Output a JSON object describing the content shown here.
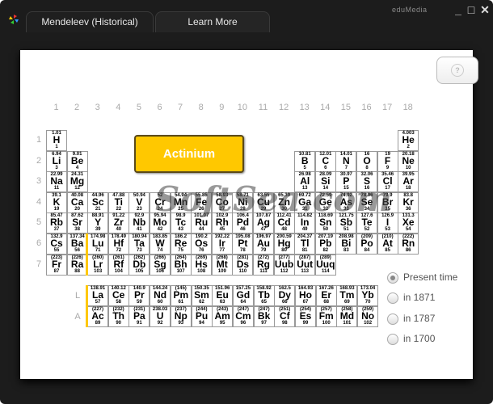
{
  "window": {
    "brand": "eduMedia",
    "controls": {
      "minimize": "_",
      "maximize": "□",
      "close": "✕"
    }
  },
  "tabs": [
    {
      "label": "Mendeleev (Historical)",
      "active": true
    },
    {
      "label": "Learn More",
      "active": false
    }
  ],
  "help": {
    "label": "?"
  },
  "groups": [
    "1",
    "2",
    "3",
    "4",
    "5",
    "6",
    "7",
    "8",
    "9",
    "10",
    "11",
    "12",
    "13",
    "14",
    "15",
    "16",
    "17",
    "18"
  ],
  "periods": [
    "1",
    "2",
    "3",
    "4",
    "5",
    "6",
    "7"
  ],
  "series_labels": {
    "lanthanides": "L",
    "actinides": "A"
  },
  "selected_element": "Actinium",
  "accent_color": "#ffc800",
  "elements": [
    {
      "s": "H",
      "n": "1",
      "m": "1.01",
      "p": 1,
      "g": 1
    },
    {
      "s": "He",
      "n": "2",
      "m": "4.003",
      "p": 1,
      "g": 18
    },
    {
      "s": "Li",
      "n": "3",
      "m": "6.94",
      "p": 2,
      "g": 1
    },
    {
      "s": "Be",
      "n": "4",
      "m": "9.01",
      "p": 2,
      "g": 2
    },
    {
      "s": "B",
      "n": "5",
      "m": "10.81",
      "p": 2,
      "g": 13
    },
    {
      "s": "C",
      "n": "6",
      "m": "12.01",
      "p": 2,
      "g": 14
    },
    {
      "s": "N",
      "n": "7",
      "m": "14.01",
      "p": 2,
      "g": 15
    },
    {
      "s": "O",
      "n": "8",
      "m": "16",
      "p": 2,
      "g": 16
    },
    {
      "s": "F",
      "n": "9",
      "m": "19",
      "p": 2,
      "g": 17
    },
    {
      "s": "Ne",
      "n": "10",
      "m": "20.18",
      "p": 2,
      "g": 18
    },
    {
      "s": "Na",
      "n": "11",
      "m": "22.99",
      "p": 3,
      "g": 1
    },
    {
      "s": "Mg",
      "n": "12",
      "m": "24.31",
      "p": 3,
      "g": 2
    },
    {
      "s": "Al",
      "n": "13",
      "m": "26.98",
      "p": 3,
      "g": 13
    },
    {
      "s": "Si",
      "n": "14",
      "m": "28.09",
      "p": 3,
      "g": 14
    },
    {
      "s": "P",
      "n": "15",
      "m": "30.97",
      "p": 3,
      "g": 15
    },
    {
      "s": "S",
      "n": "16",
      "m": "32.06",
      "p": 3,
      "g": 16
    },
    {
      "s": "Cl",
      "n": "17",
      "m": "35.46",
      "p": 3,
      "g": 17
    },
    {
      "s": "Ar",
      "n": "18",
      "m": "39.95",
      "p": 3,
      "g": 18
    },
    {
      "s": "K",
      "n": "19",
      "m": "39.1",
      "p": 4,
      "g": 1
    },
    {
      "s": "Ca",
      "n": "20",
      "m": "40.08",
      "p": 4,
      "g": 2
    },
    {
      "s": "Sc",
      "n": "21",
      "m": "44.96",
      "p": 4,
      "g": 3
    },
    {
      "s": "Ti",
      "n": "22",
      "m": "47.88",
      "p": 4,
      "g": 4
    },
    {
      "s": "V",
      "n": "23",
      "m": "50.94",
      "p": 4,
      "g": 5
    },
    {
      "s": "Cr",
      "n": "24",
      "m": "52",
      "p": 4,
      "g": 6
    },
    {
      "s": "Mn",
      "n": "25",
      "m": "54.94",
      "p": 4,
      "g": 7
    },
    {
      "s": "Fe",
      "n": "26",
      "m": "55.85",
      "p": 4,
      "g": 8
    },
    {
      "s": "Co",
      "n": "27",
      "m": "58.93",
      "p": 4,
      "g": 9
    },
    {
      "s": "Ni",
      "n": "28",
      "m": "58.71",
      "p": 4,
      "g": 10
    },
    {
      "s": "Cu",
      "n": "29",
      "m": "63.55",
      "p": 4,
      "g": 11
    },
    {
      "s": "Zn",
      "n": "30",
      "m": "65.39",
      "p": 4,
      "g": 12
    },
    {
      "s": "Ga",
      "n": "31",
      "m": "69.72",
      "p": 4,
      "g": 13
    },
    {
      "s": "Ge",
      "n": "32",
      "m": "72.59",
      "p": 4,
      "g": 14
    },
    {
      "s": "As",
      "n": "33",
      "m": "74.92",
      "p": 4,
      "g": 15
    },
    {
      "s": "Se",
      "n": "34",
      "m": "78.96",
      "p": 4,
      "g": 16
    },
    {
      "s": "Br",
      "n": "35",
      "m": "79.9",
      "p": 4,
      "g": 17
    },
    {
      "s": "Kr",
      "n": "36",
      "m": "83.8",
      "p": 4,
      "g": 18
    },
    {
      "s": "Rb",
      "n": "37",
      "m": "85.47",
      "p": 5,
      "g": 1
    },
    {
      "s": "Sr",
      "n": "38",
      "m": "87.62",
      "p": 5,
      "g": 2
    },
    {
      "s": "Y",
      "n": "39",
      "m": "88.91",
      "p": 5,
      "g": 3
    },
    {
      "s": "Zr",
      "n": "40",
      "m": "91.22",
      "p": 5,
      "g": 4
    },
    {
      "s": "Nb",
      "n": "41",
      "m": "92.9",
      "p": 5,
      "g": 5
    },
    {
      "s": "Mo",
      "n": "42",
      "m": "95.94",
      "p": 5,
      "g": 6
    },
    {
      "s": "Tc",
      "n": "43",
      "m": "98.9",
      "p": 5,
      "g": 7
    },
    {
      "s": "Ru",
      "n": "44",
      "m": "101.07",
      "p": 5,
      "g": 8
    },
    {
      "s": "Rh",
      "n": "45",
      "m": "102.9",
      "p": 5,
      "g": 9
    },
    {
      "s": "Pd",
      "n": "46",
      "m": "106.4",
      "p": 5,
      "g": 10
    },
    {
      "s": "Ag",
      "n": "47",
      "m": "107.87",
      "p": 5,
      "g": 11
    },
    {
      "s": "Cd",
      "n": "48",
      "m": "112.41",
      "p": 5,
      "g": 12
    },
    {
      "s": "In",
      "n": "49",
      "m": "114.82",
      "p": 5,
      "g": 13
    },
    {
      "s": "Sn",
      "n": "50",
      "m": "118.69",
      "p": 5,
      "g": 14
    },
    {
      "s": "Sb",
      "n": "51",
      "m": "121.75",
      "p": 5,
      "g": 15
    },
    {
      "s": "Te",
      "n": "52",
      "m": "127.6",
      "p": 5,
      "g": 16
    },
    {
      "s": "I",
      "n": "53",
      "m": "126.9",
      "p": 5,
      "g": 17
    },
    {
      "s": "Xe",
      "n": "54",
      "m": "131.3",
      "p": 5,
      "g": 18
    },
    {
      "s": "Cs",
      "n": "55",
      "m": "132.9",
      "p": 6,
      "g": 1
    },
    {
      "s": "Ba",
      "n": "56",
      "m": "137.34",
      "p": 6,
      "g": 2
    },
    {
      "s": "Lu",
      "n": "71",
      "m": "174.98",
      "p": 6,
      "g": 3
    },
    {
      "s": "Hf",
      "n": "72",
      "m": "178.49",
      "p": 6,
      "g": 4
    },
    {
      "s": "Ta",
      "n": "73",
      "m": "180.94",
      "p": 6,
      "g": 5
    },
    {
      "s": "W",
      "n": "74",
      "m": "183.85",
      "p": 6,
      "g": 6
    },
    {
      "s": "Re",
      "n": "75",
      "m": "186.2",
      "p": 6,
      "g": 7
    },
    {
      "s": "Os",
      "n": "76",
      "m": "190.2",
      "p": 6,
      "g": 8
    },
    {
      "s": "Ir",
      "n": "77",
      "m": "192.22",
      "p": 6,
      "g": 9
    },
    {
      "s": "Pt",
      "n": "78",
      "m": "195.08",
      "p": 6,
      "g": 10
    },
    {
      "s": "Au",
      "n": "79",
      "m": "196.97",
      "p": 6,
      "g": 11
    },
    {
      "s": "Hg",
      "n": "80",
      "m": "200.59",
      "p": 6,
      "g": 12
    },
    {
      "s": "Tl",
      "n": "81",
      "m": "204.37",
      "p": 6,
      "g": 13
    },
    {
      "s": "Pb",
      "n": "82",
      "m": "207.19",
      "p": 6,
      "g": 14
    },
    {
      "s": "Bi",
      "n": "83",
      "m": "208.98",
      "p": 6,
      "g": 15
    },
    {
      "s": "Po",
      "n": "84",
      "m": "(209)",
      "p": 6,
      "g": 16
    },
    {
      "s": "At",
      "n": "85",
      "m": "(210)",
      "p": 6,
      "g": 17
    },
    {
      "s": "Rn",
      "n": "86",
      "m": "(222)",
      "p": 6,
      "g": 18
    },
    {
      "s": "Fr",
      "n": "87",
      "m": "(223)",
      "p": 7,
      "g": 1
    },
    {
      "s": "Ra",
      "n": "88",
      "m": "(226)",
      "p": 7,
      "g": 2
    },
    {
      "s": "Lr",
      "n": "103",
      "m": "(260)",
      "p": 7,
      "g": 3
    },
    {
      "s": "Rf",
      "n": "104",
      "m": "(261)",
      "p": 7,
      "g": 4
    },
    {
      "s": "Db",
      "n": "105",
      "m": "(262)",
      "p": 7,
      "g": 5
    },
    {
      "s": "Sg",
      "n": "106",
      "m": "(266)",
      "p": 7,
      "g": 6
    },
    {
      "s": "Bh",
      "n": "107",
      "m": "(264)",
      "p": 7,
      "g": 7
    },
    {
      "s": "Hs",
      "n": "108",
      "m": "(269)",
      "p": 7,
      "g": 8
    },
    {
      "s": "Mt",
      "n": "109",
      "m": "(268)",
      "p": 7,
      "g": 9
    },
    {
      "s": "Ds",
      "n": "110",
      "m": "(281)",
      "p": 7,
      "g": 10
    },
    {
      "s": "Rg",
      "n": "111",
      "m": "(272)",
      "p": 7,
      "g": 11
    },
    {
      "s": "Uub",
      "n": "112",
      "m": "(277)",
      "p": 7,
      "g": 12
    },
    {
      "s": "Uut",
      "n": "113",
      "m": "(287)",
      "p": 7,
      "g": 13
    },
    {
      "s": "Uuq",
      "n": "114",
      "m": "(289)",
      "p": 7,
      "g": 14
    }
  ],
  "lanthanides": [
    {
      "s": "La",
      "n": "57",
      "m": "138.91"
    },
    {
      "s": "Ce",
      "n": "58",
      "m": "140.12"
    },
    {
      "s": "Pr",
      "n": "59",
      "m": "140.9"
    },
    {
      "s": "Nd",
      "n": "60",
      "m": "144.24"
    },
    {
      "s": "Pm",
      "n": "61",
      "m": "(145)"
    },
    {
      "s": "Sm",
      "n": "62",
      "m": "150.35"
    },
    {
      "s": "Eu",
      "n": "63",
      "m": "151.96"
    },
    {
      "s": "Gd",
      "n": "64",
      "m": "157.25"
    },
    {
      "s": "Tb",
      "n": "65",
      "m": "158.92"
    },
    {
      "s": "Dy",
      "n": "66",
      "m": "162.5"
    },
    {
      "s": "Ho",
      "n": "67",
      "m": "164.93"
    },
    {
      "s": "Er",
      "n": "68",
      "m": "167.26"
    },
    {
      "s": "Tm",
      "n": "69",
      "m": "168.93"
    },
    {
      "s": "Yb",
      "n": "70",
      "m": "173.04"
    }
  ],
  "actinides": [
    {
      "s": "Ac",
      "n": "89",
      "m": "(227)"
    },
    {
      "s": "Th",
      "n": "90",
      "m": "(232)"
    },
    {
      "s": "Pa",
      "n": "91",
      "m": "(231)"
    },
    {
      "s": "U",
      "n": "92",
      "m": "238.03"
    },
    {
      "s": "Np",
      "n": "93",
      "m": "(237)"
    },
    {
      "s": "Pu",
      "n": "94",
      "m": "(244)"
    },
    {
      "s": "Am",
      "n": "95",
      "m": "(243)"
    },
    {
      "s": "Cm",
      "n": "96",
      "m": "(247)"
    },
    {
      "s": "Bk",
      "n": "97",
      "m": "(247)"
    },
    {
      "s": "Cf",
      "n": "98",
      "m": "(251)"
    },
    {
      "s": "Es",
      "n": "99",
      "m": "(254)"
    },
    {
      "s": "Fm",
      "n": "100",
      "m": "(257)"
    },
    {
      "s": "Md",
      "n": "101",
      "m": "(258)"
    },
    {
      "s": "No",
      "n": "102",
      "m": "(259)"
    }
  ],
  "time_options": [
    {
      "label": "Present time",
      "selected": true
    },
    {
      "label": "in 1871",
      "selected": false
    },
    {
      "label": "in 1787",
      "selected": false
    },
    {
      "label": "in 1700",
      "selected": false
    }
  ],
  "watermark": "SoftSea.com"
}
